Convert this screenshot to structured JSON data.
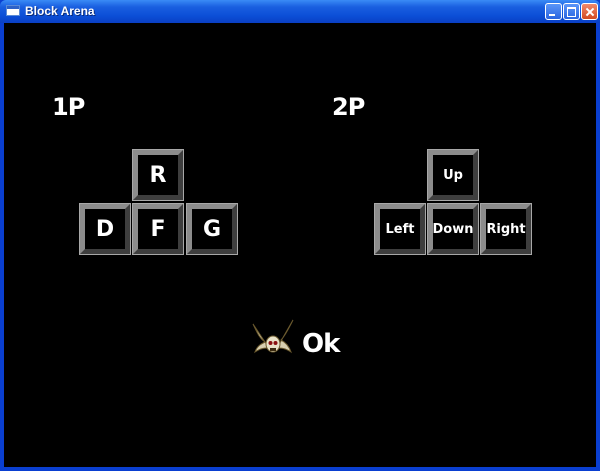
{
  "window": {
    "title": "Block Arena"
  },
  "player1": {
    "label": "1P",
    "keys": {
      "up": "R",
      "left": "D",
      "down": "F",
      "right": "G"
    }
  },
  "player2": {
    "label": "2P",
    "keys": {
      "up": "Up",
      "left": "Left",
      "down": "Down",
      "right": "Right"
    }
  },
  "ok": {
    "label": "Ok",
    "icon": "winged-skull-icon"
  }
}
